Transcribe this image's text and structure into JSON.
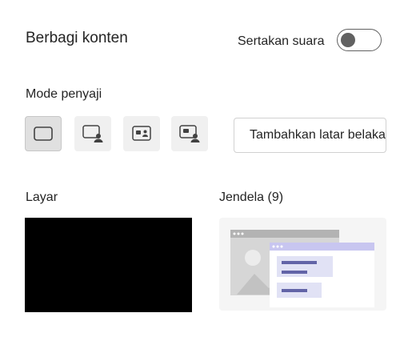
{
  "share": {
    "title": "Berbagi konten",
    "include_audio_label": "Sertakan suara",
    "include_audio_on": false
  },
  "presenter_mode": {
    "label": "Mode penyaji",
    "modes": [
      {
        "icon": "content-only-icon",
        "selected": true
      },
      {
        "icon": "standout-icon",
        "selected": false
      },
      {
        "icon": "side-by-side-icon",
        "selected": false
      },
      {
        "icon": "reporter-icon",
        "selected": false
      }
    ],
    "add_background_label": "Tambahkan latar belakang"
  },
  "sources": {
    "screen_label": "Layar",
    "window_label": "Jendela (9)"
  },
  "colors": {
    "accent": "#6264a7",
    "accent_light": "#e1e2f5",
    "window_header": "#c8c6f0"
  }
}
